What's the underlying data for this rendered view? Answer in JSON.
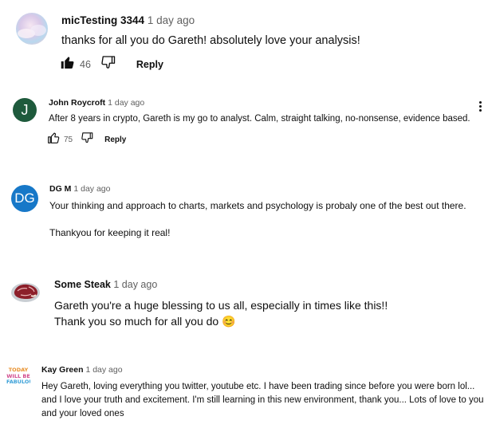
{
  "comments": [
    {
      "author": "micTesting 3344",
      "time": "1 day ago",
      "text": [
        "thanks for all you do Gareth! absolutely love your analysis!"
      ],
      "likes": "46",
      "reply_label": "Reply"
    },
    {
      "author": "John Roycroft",
      "time": "1 day ago",
      "avatar_letter": "J",
      "avatar_color": "#1e5a3c",
      "text": [
        "After 8 years in crypto, Gareth is my go to analyst. Calm, straight talking, no-nonsense, evidence based."
      ],
      "likes": "75",
      "reply_label": "Reply"
    },
    {
      "author": "DG M",
      "time": "1 day ago",
      "avatar_letter": "DG",
      "avatar_color": "#1778c8",
      "text": [
        "Your thinking and approach to charts, markets and psychology is probaly one of the best out there.",
        "Thankyou for keeping it real!"
      ]
    },
    {
      "author": "Some Steak",
      "time": "1 day ago",
      "text": [
        "Gareth you're a huge blessing to us all, especially in times like this!!",
        "Thank you so much for all you do 😊"
      ]
    },
    {
      "author": "Kay Green",
      "time": "1 day ago",
      "avatar_logo_lines": [
        "TODAY",
        "WILL BE",
        "FABULOUS"
      ],
      "text": [
        "Hey Gareth, loving everything you twitter, youtube etc. I have been trading since before you were born lol... and I love your truth and excitement. I'm still learning in this new environment, thank you... Lots of love to you and your loved ones"
      ]
    }
  ]
}
